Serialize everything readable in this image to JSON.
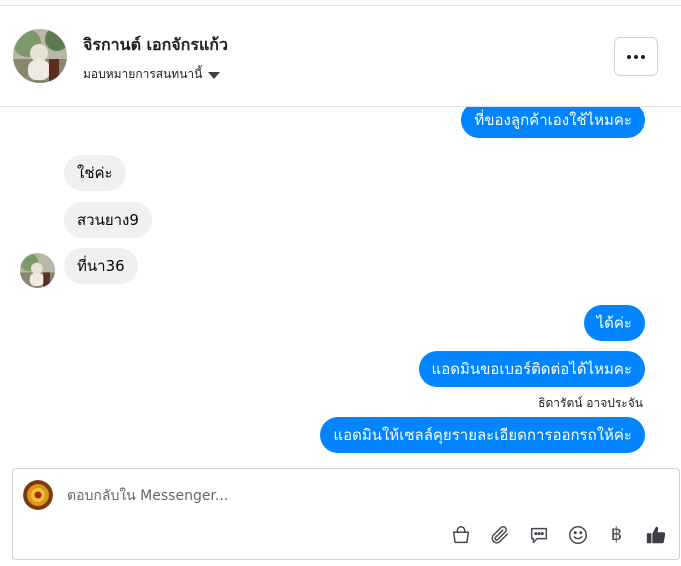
{
  "header": {
    "contact_name": "จิรกานต์ เอกจักรแก้ว",
    "assign_label": "มอบหมายการสนทนานี้",
    "more_label": "•••"
  },
  "messages": [
    {
      "direction": "outgoing",
      "text": "ที่ของลูกค้าเองใช้ไหมคะ"
    },
    {
      "direction": "incoming",
      "text": "ใช่ค่ะ"
    },
    {
      "direction": "incoming",
      "text": "สวนยาง9"
    },
    {
      "direction": "incoming",
      "text": "ที่นา36"
    },
    {
      "direction": "outgoing",
      "text": "ได้ค่ะ"
    },
    {
      "direction": "outgoing",
      "text": "แอดมินขอเบอร์ติดต่อได้ไหมคะ"
    },
    {
      "direction": "outgoing",
      "text": "แอดมินให้เซลล์คุยรายละเอียดการออกรถให้ค่ะ"
    }
  ],
  "sender_name": "ธิดารัตน์ อาจประจัน",
  "composer": {
    "placeholder": "ตอบกลับใน Messenger...",
    "baht_symbol": "฿"
  },
  "icons": [
    "bag-icon",
    "paperclip-icon",
    "chat-bubble-icon",
    "smile-icon",
    "baht-icon",
    "thumbs-up-icon"
  ],
  "colors": {
    "outgoing_bubble": "#0084ff",
    "incoming_bubble": "#f0f0f0",
    "divider": "#dddfe2"
  }
}
